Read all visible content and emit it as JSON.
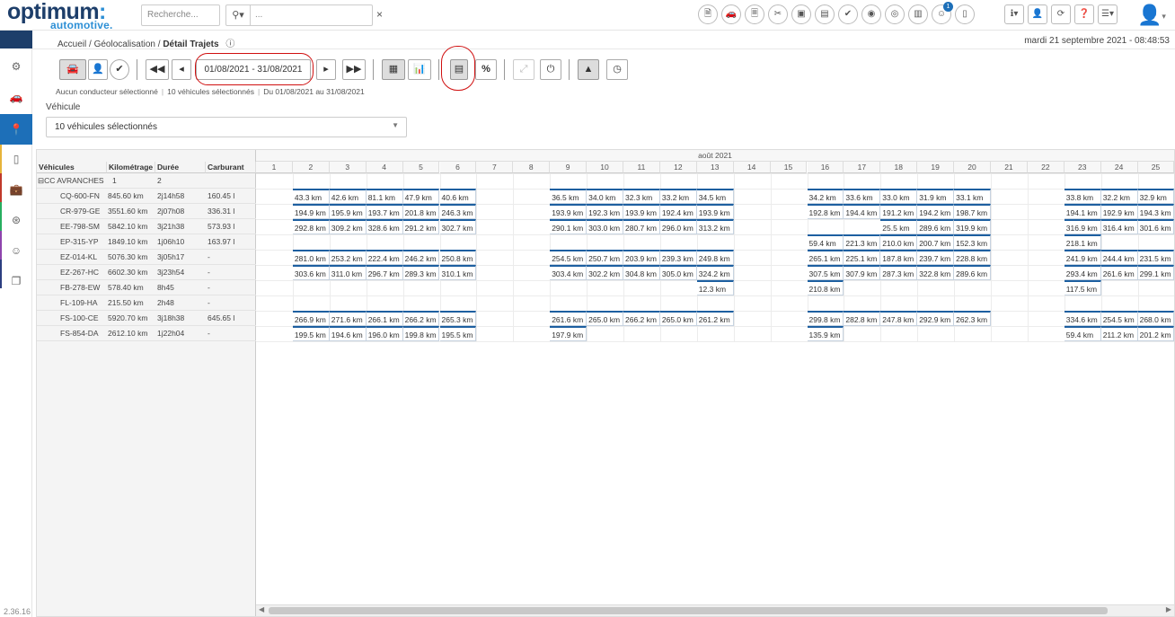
{
  "brand": {
    "name": "optimum",
    "dot": ":",
    "sub": "automotive",
    "sub_dot": "."
  },
  "search": {
    "placeholder": "Recherche...",
    "location_placeholder": "...",
    "clear": "×",
    "loc_icon": "⚲▾"
  },
  "tool_icons": [
    "document-icon",
    "car-user-icon",
    "car-file-icon",
    "tools-icon",
    "fuel-card-icon",
    "toll-icon",
    "wrench-icon",
    "car-search-icon",
    "car-alert-icon",
    "car-image-icon",
    "driver-icon",
    "phone-car-icon"
  ],
  "notification_badge": "1",
  "right_icons": [
    {
      "name": "info-menu",
      "label": "ℹ▾"
    },
    {
      "name": "driver-user",
      "label": "👤"
    },
    {
      "name": "refresh",
      "label": "⟳"
    },
    {
      "name": "help",
      "label": "❓"
    },
    {
      "name": "menu",
      "label": "☰▾"
    }
  ],
  "breadcrumb": {
    "home": "Accueil",
    "sep": "/",
    "section": "Géolocalisation",
    "current": "Détail Trajets"
  },
  "datetime": "mardi 21 septembre 2021 - 08:48:53",
  "version": "2.36.16",
  "toolbar": {
    "date_range": "01/08/2021 - 31/08/2021",
    "percent": "%"
  },
  "filter_summary": {
    "driver": "Aucun conducteur sélectionné",
    "vehicles": "10 véhicules sélectionnés",
    "period": "Du 01/08/2021 au 31/08/2021",
    "separator": "|"
  },
  "vehicle_filter": {
    "label": "Véhicule",
    "value": "10 véhicules sélectionnés"
  },
  "grid": {
    "month": "août 2021",
    "columns": {
      "vehicle": "Véhicules",
      "mileage": "Kilométrage",
      "duration": "Durée",
      "fuel": "Carburant"
    },
    "days": [
      "1",
      "2",
      "3",
      "4",
      "5",
      "6",
      "7",
      "8",
      "9",
      "10",
      "11",
      "12",
      "13",
      "14",
      "15",
      "16",
      "17",
      "18",
      "19",
      "20",
      "21",
      "22",
      "23",
      "24",
      "25"
    ],
    "group": {
      "name": "⊟CC AVRANCHES",
      "mileage": "1",
      "duration": "2",
      "fuel": ""
    },
    "vehicles": [
      {
        "plate": "CQ-600-FN",
        "mileage": "845.60 km",
        "duration": "2j14h58",
        "fuel": "160.45 l",
        "days": [
          "",
          "43.3 km",
          "42.6 km",
          "81.1 km",
          "47.9 km",
          "40.6 km",
          "",
          "",
          "36.5 km",
          "34.0 km",
          "32.3 km",
          "33.2 km",
          "34.5 km",
          "",
          "",
          "34.2 km",
          "33.6 km",
          "33.0 km",
          "31.9 km",
          "33.1 km",
          "",
          "",
          "33.8 km",
          "32.2 km",
          "32.9 km"
        ]
      },
      {
        "plate": "CR-979-GE",
        "mileage": "3551.60 km",
        "duration": "2j07h08",
        "fuel": "336.31 l",
        "days": [
          "",
          "194.9 km",
          "195.9 km",
          "193.7 km",
          "201.8 km",
          "246.3 km",
          "",
          "",
          "193.9 km",
          "192.3 km",
          "193.9 km",
          "192.4 km",
          "193.9 km",
          "",
          "",
          "192.8 km",
          "194.4 km",
          "191.2 km",
          "194.2 km",
          "198.7 km",
          "",
          "",
          "194.1 km",
          "192.9 km",
          "194.3 km"
        ]
      },
      {
        "plate": "EE-798-SM",
        "mileage": "5842.10 km",
        "duration": "3j21h38",
        "fuel": "573.93 l",
        "days": [
          "",
          "292.8 km",
          "309.2 km",
          "328.6 km",
          "291.2 km",
          "302.7 km",
          "",
          "",
          "290.1 km",
          "303.0 km",
          "280.7 km",
          "296.0 km",
          "313.2 km",
          "",
          "",
          "",
          "",
          "25.5 km",
          "289.6 km",
          "319.9 km",
          "",
          "",
          "316.9 km",
          "316.4 km",
          "301.6 km"
        ]
      },
      {
        "plate": "EP-315-YP",
        "mileage": "1849.10 km",
        "duration": "1j06h10",
        "fuel": "163.97 l",
        "days": [
          "",
          "",
          "",
          "",
          "",
          "",
          "",
          "",
          "",
          "",
          "",
          "",
          "",
          "",
          "",
          "59.4 km",
          "221.3 km",
          "210.0 km",
          "200.7 km",
          "152.3 km",
          "",
          "",
          "218.1 km",
          "",
          ""
        ]
      },
      {
        "plate": "EZ-014-KL",
        "mileage": "5076.30 km",
        "duration": "3j05h17",
        "fuel": "-",
        "days": [
          "",
          "281.0 km",
          "253.2 km",
          "222.4 km",
          "246.2 km",
          "250.8 km",
          "",
          "",
          "254.5 km",
          "250.7 km",
          "203.9 km",
          "239.3 km",
          "249.8 km",
          "",
          "",
          "265.1 km",
          "225.1 km",
          "187.8 km",
          "239.7 km",
          "228.8 km",
          "",
          "",
          "241.9 km",
          "244.4 km",
          "231.5 km"
        ]
      },
      {
        "plate": "EZ-267-HC",
        "mileage": "6602.30 km",
        "duration": "3j23h54",
        "fuel": "-",
        "days": [
          "",
          "303.6 km",
          "311.0 km",
          "296.7 km",
          "289.3 km",
          "310.1 km",
          "",
          "",
          "303.4 km",
          "302.2 km",
          "304.8 km",
          "305.0 km",
          "324.2 km",
          "",
          "",
          "307.5 km",
          "307.9 km",
          "287.3 km",
          "322.8 km",
          "289.6 km",
          "",
          "",
          "293.4 km",
          "261.6 km",
          "299.1 km"
        ]
      },
      {
        "plate": "FB-278-EW",
        "mileage": "578.40 km",
        "duration": "8h45",
        "fuel": "-",
        "days": [
          "",
          "",
          "",
          "",
          "",
          "",
          "",
          "",
          "",
          "",
          "",
          "",
          "12.3 km",
          "",
          "",
          "210.8 km",
          "",
          "",
          "",
          "",
          "",
          "",
          "117.5 km",
          "",
          ""
        ]
      },
      {
        "plate": "FL-109-HA",
        "mileage": "215.50 km",
        "duration": "2h48",
        "fuel": "-",
        "days": [
          "",
          "",
          "",
          "",
          "",
          "",
          "",
          "",
          "",
          "",
          "",
          "",
          "",
          "",
          "",
          "",
          "",
          "",
          "",
          "",
          "",
          "",
          "",
          "",
          ""
        ]
      },
      {
        "plate": "FS-100-CE",
        "mileage": "5920.70 km",
        "duration": "3j18h38",
        "fuel": "645.65 l",
        "days": [
          "",
          "266.9 km",
          "271.6 km",
          "266.1 km",
          "266.2 km",
          "265.3 km",
          "",
          "",
          "261.6 km",
          "265.0 km",
          "266.2 km",
          "265.0 km",
          "261.2 km",
          "",
          "",
          "299.8 km",
          "282.8 km",
          "247.8 km",
          "292.9 km",
          "262.3 km",
          "",
          "",
          "334.6 km",
          "254.5 km",
          "268.0 km"
        ]
      },
      {
        "plate": "FS-854-DA",
        "mileage": "2612.10 km",
        "duration": "1j22h04",
        "fuel": "-",
        "days": [
          "",
          "199.5 km",
          "194.6 km",
          "196.0 km",
          "199.8 km",
          "195.5 km",
          "",
          "",
          "197.9 km",
          "",
          "",
          "",
          "",
          "",
          "",
          "135.9 km",
          "",
          "",
          "",
          "",
          "",
          "",
          "59.4 km",
          "211.2 km",
          "201.2 km"
        ]
      }
    ]
  }
}
